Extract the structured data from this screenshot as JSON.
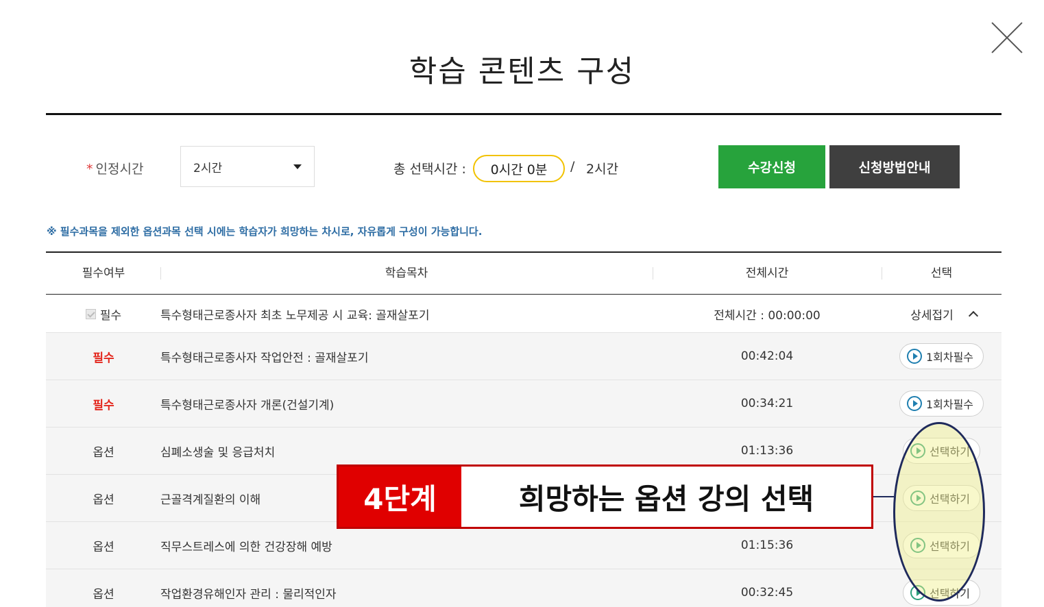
{
  "modal": {
    "title": "학습 콘텐츠 구성",
    "close_icon": "close-icon"
  },
  "filters": {
    "required_mark": "*",
    "credit_hours_label": "인정시간",
    "credit_hours_value": "2시간",
    "total_selected_label": "총 선택시간 :",
    "total_selected_value": "0시간 0분",
    "separator": "/",
    "total_max": "2시간"
  },
  "actions": {
    "apply_label": "수강신청",
    "guide_label": "신청방법안내"
  },
  "notice": "※ 필수과목을 제외한 옵션과목 선택 시에는 학습자가 희망하는 차시로, 자유롭게 구성이 가능합니다.",
  "table": {
    "headers": [
      "필수여부",
      "학습목차",
      "전체시간",
      "선택"
    ],
    "group": {
      "required_label": "필수",
      "title": "특수형태근로종사자 최초 노무제공 시 교육: 골재살포기",
      "total_time": "전체시간 : 00:00:00",
      "fold_label": "상세접기"
    },
    "rows": [
      {
        "type": "필수",
        "title": "특수형태근로종사자 작업안전 : 골재살포기",
        "time": "00:42:04",
        "button": "1회차필수"
      },
      {
        "type": "필수",
        "title": "특수형태근로종사자 개론(건설기계)",
        "time": "00:34:21",
        "button": "1회차필수"
      },
      {
        "type": "옵션",
        "title": "심폐소생술 및 응급처치",
        "time": "01:13:36",
        "button": "선택하기"
      },
      {
        "type": "옵션",
        "title": "근골격계질환의 이해",
        "time": "",
        "button": "선택하기"
      },
      {
        "type": "옵션",
        "title": "직무스트레스에 의한 건강장해 예방",
        "time": "01:15:36",
        "button": "선택하기"
      },
      {
        "type": "옵션",
        "title": "작업환경유해인자 관리 : 물리적인자",
        "time": "00:32:45",
        "button": "선택하기"
      }
    ]
  },
  "callout": {
    "step": "4단계",
    "text": "희망하는 옵션 강의 선택"
  },
  "colors": {
    "apply_green": "#27a33c",
    "guide_dark": "#3f3f3f",
    "required_red": "#e3261c",
    "notice_blue": "#2e6da4",
    "pill_yellow": "#f2c200",
    "callout_red": "#e00000"
  }
}
